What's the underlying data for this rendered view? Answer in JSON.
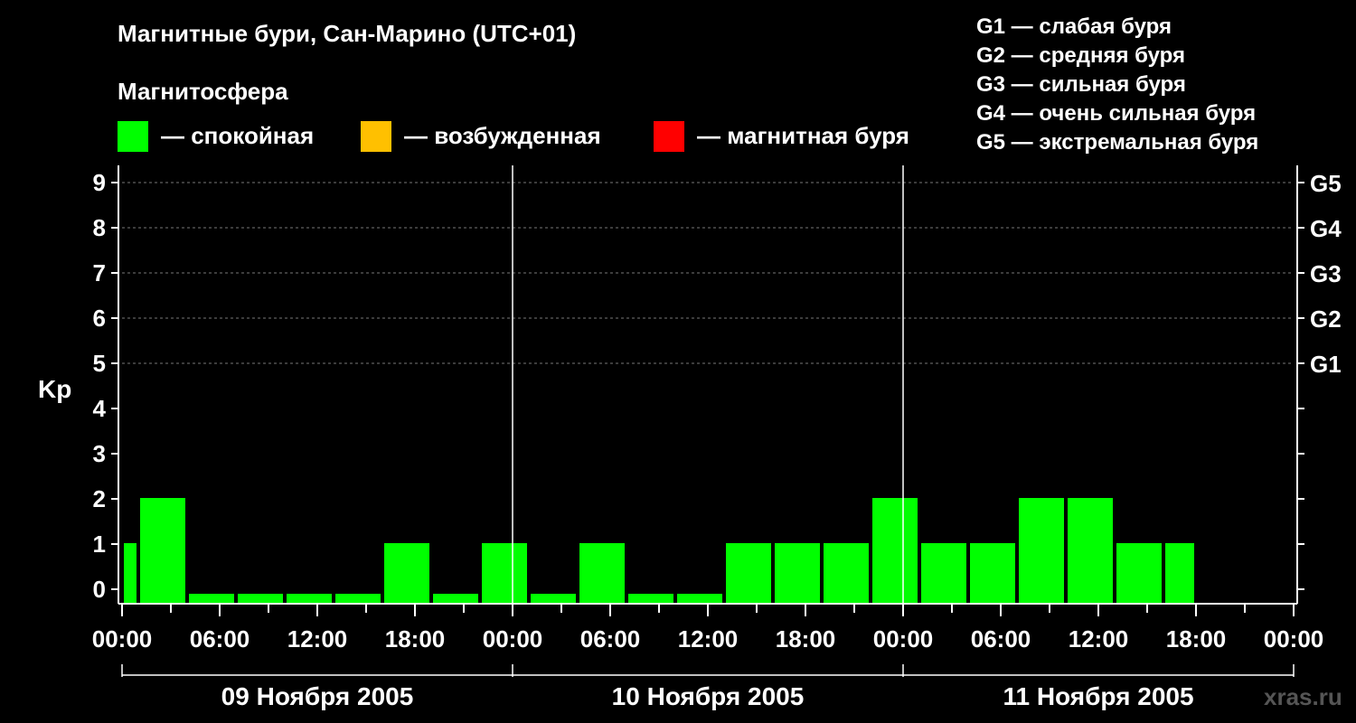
{
  "title": "Магнитные бури, Сан-Марино (UTC+01)",
  "subtitle": "Магнитосфера",
  "legend": [
    {
      "label": "— спокойная",
      "color": "#00ff00"
    },
    {
      "label": "— возбужденная",
      "color": "#ffc000"
    },
    {
      "label": "— магнитная буря",
      "color": "#ff0000"
    }
  ],
  "g_legend": [
    "G1 — слабая буря",
    "G2 — средняя буря",
    "G3 — сильная буря",
    "G4 — очень сильная буря",
    "G5 — экстремальная буря"
  ],
  "watermark": "xras.ru",
  "chart_data": {
    "type": "bar",
    "ylabel": "Kp",
    "ylim": [
      0,
      9
    ],
    "yticks": [
      "0",
      "1",
      "2",
      "3",
      "4",
      "5",
      "6",
      "7",
      "8",
      "9"
    ],
    "right_ticks": [
      {
        "value": 5,
        "label": "G1"
      },
      {
        "value": 6,
        "label": "G2"
      },
      {
        "value": 7,
        "label": "G3"
      },
      {
        "value": 8,
        "label": "G4"
      },
      {
        "value": 9,
        "label": "G5"
      }
    ],
    "xlim_hours": [
      0,
      72
    ],
    "xtick_labels": [
      "00:00",
      "06:00",
      "12:00",
      "18:00",
      "00:00",
      "06:00",
      "12:00",
      "18:00",
      "00:00",
      "06:00",
      "12:00",
      "18:00",
      "00:00"
    ],
    "days": [
      "09 Ноября 2005",
      "10 Ноября 2005",
      "11 Ноября 2005"
    ],
    "grid": "dashed at 5-9",
    "bars": [
      {
        "start": 0,
        "end": 1,
        "kp": 1,
        "color": "#00ff00"
      },
      {
        "start": 1,
        "end": 4,
        "kp": 2,
        "color": "#00ff00"
      },
      {
        "start": 4,
        "end": 7,
        "kp": 0,
        "color": "#00ff00"
      },
      {
        "start": 7,
        "end": 10,
        "kp": 0,
        "color": "#00ff00"
      },
      {
        "start": 10,
        "end": 13,
        "kp": 0,
        "color": "#00ff00"
      },
      {
        "start": 13,
        "end": 16,
        "kp": 0,
        "color": "#00ff00"
      },
      {
        "start": 16,
        "end": 19,
        "kp": 1,
        "color": "#00ff00"
      },
      {
        "start": 19,
        "end": 22,
        "kp": 0,
        "color": "#00ff00"
      },
      {
        "start": 22,
        "end": 25,
        "kp": 1,
        "color": "#00ff00"
      },
      {
        "start": 25,
        "end": 28,
        "kp": 0,
        "color": "#00ff00"
      },
      {
        "start": 28,
        "end": 31,
        "kp": 1,
        "color": "#00ff00"
      },
      {
        "start": 31,
        "end": 34,
        "kp": 0,
        "color": "#00ff00"
      },
      {
        "start": 34,
        "end": 37,
        "kp": 0,
        "color": "#00ff00"
      },
      {
        "start": 37,
        "end": 40,
        "kp": 1,
        "color": "#00ff00"
      },
      {
        "start": 40,
        "end": 43,
        "kp": 1,
        "color": "#00ff00"
      },
      {
        "start": 43,
        "end": 46,
        "kp": 1,
        "color": "#00ff00"
      },
      {
        "start": 46,
        "end": 49,
        "kp": 2,
        "color": "#00ff00"
      },
      {
        "start": 49,
        "end": 52,
        "kp": 1,
        "color": "#00ff00"
      },
      {
        "start": 52,
        "end": 55,
        "kp": 1,
        "color": "#00ff00"
      },
      {
        "start": 55,
        "end": 58,
        "kp": 2,
        "color": "#00ff00"
      },
      {
        "start": 58,
        "end": 61,
        "kp": 2,
        "color": "#00ff00"
      },
      {
        "start": 61,
        "end": 64,
        "kp": 1,
        "color": "#00ff00"
      },
      {
        "start": 64,
        "end": 66,
        "kp": 1,
        "color": "#00ff00"
      }
    ]
  }
}
